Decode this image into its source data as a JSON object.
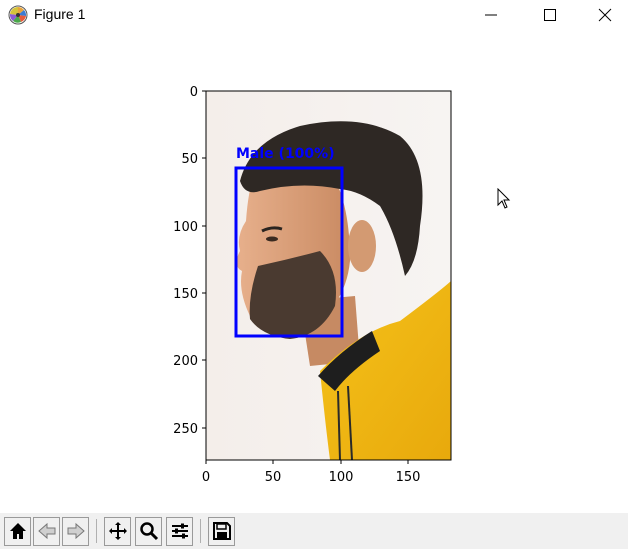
{
  "window": {
    "title": "Figure 1"
  },
  "plot": {
    "box_label": "Male (100%)",
    "x_ticks": [
      "0",
      "50",
      "100",
      "150"
    ],
    "y_ticks": [
      "0",
      "50",
      "100",
      "150",
      "200",
      "250"
    ],
    "box_color": "#0000ff"
  },
  "toolbar": {
    "icons": [
      "home-icon",
      "back-icon",
      "forward-icon",
      "pan-icon",
      "zoom-icon",
      "configure-subplots-icon",
      "save-icon"
    ]
  }
}
